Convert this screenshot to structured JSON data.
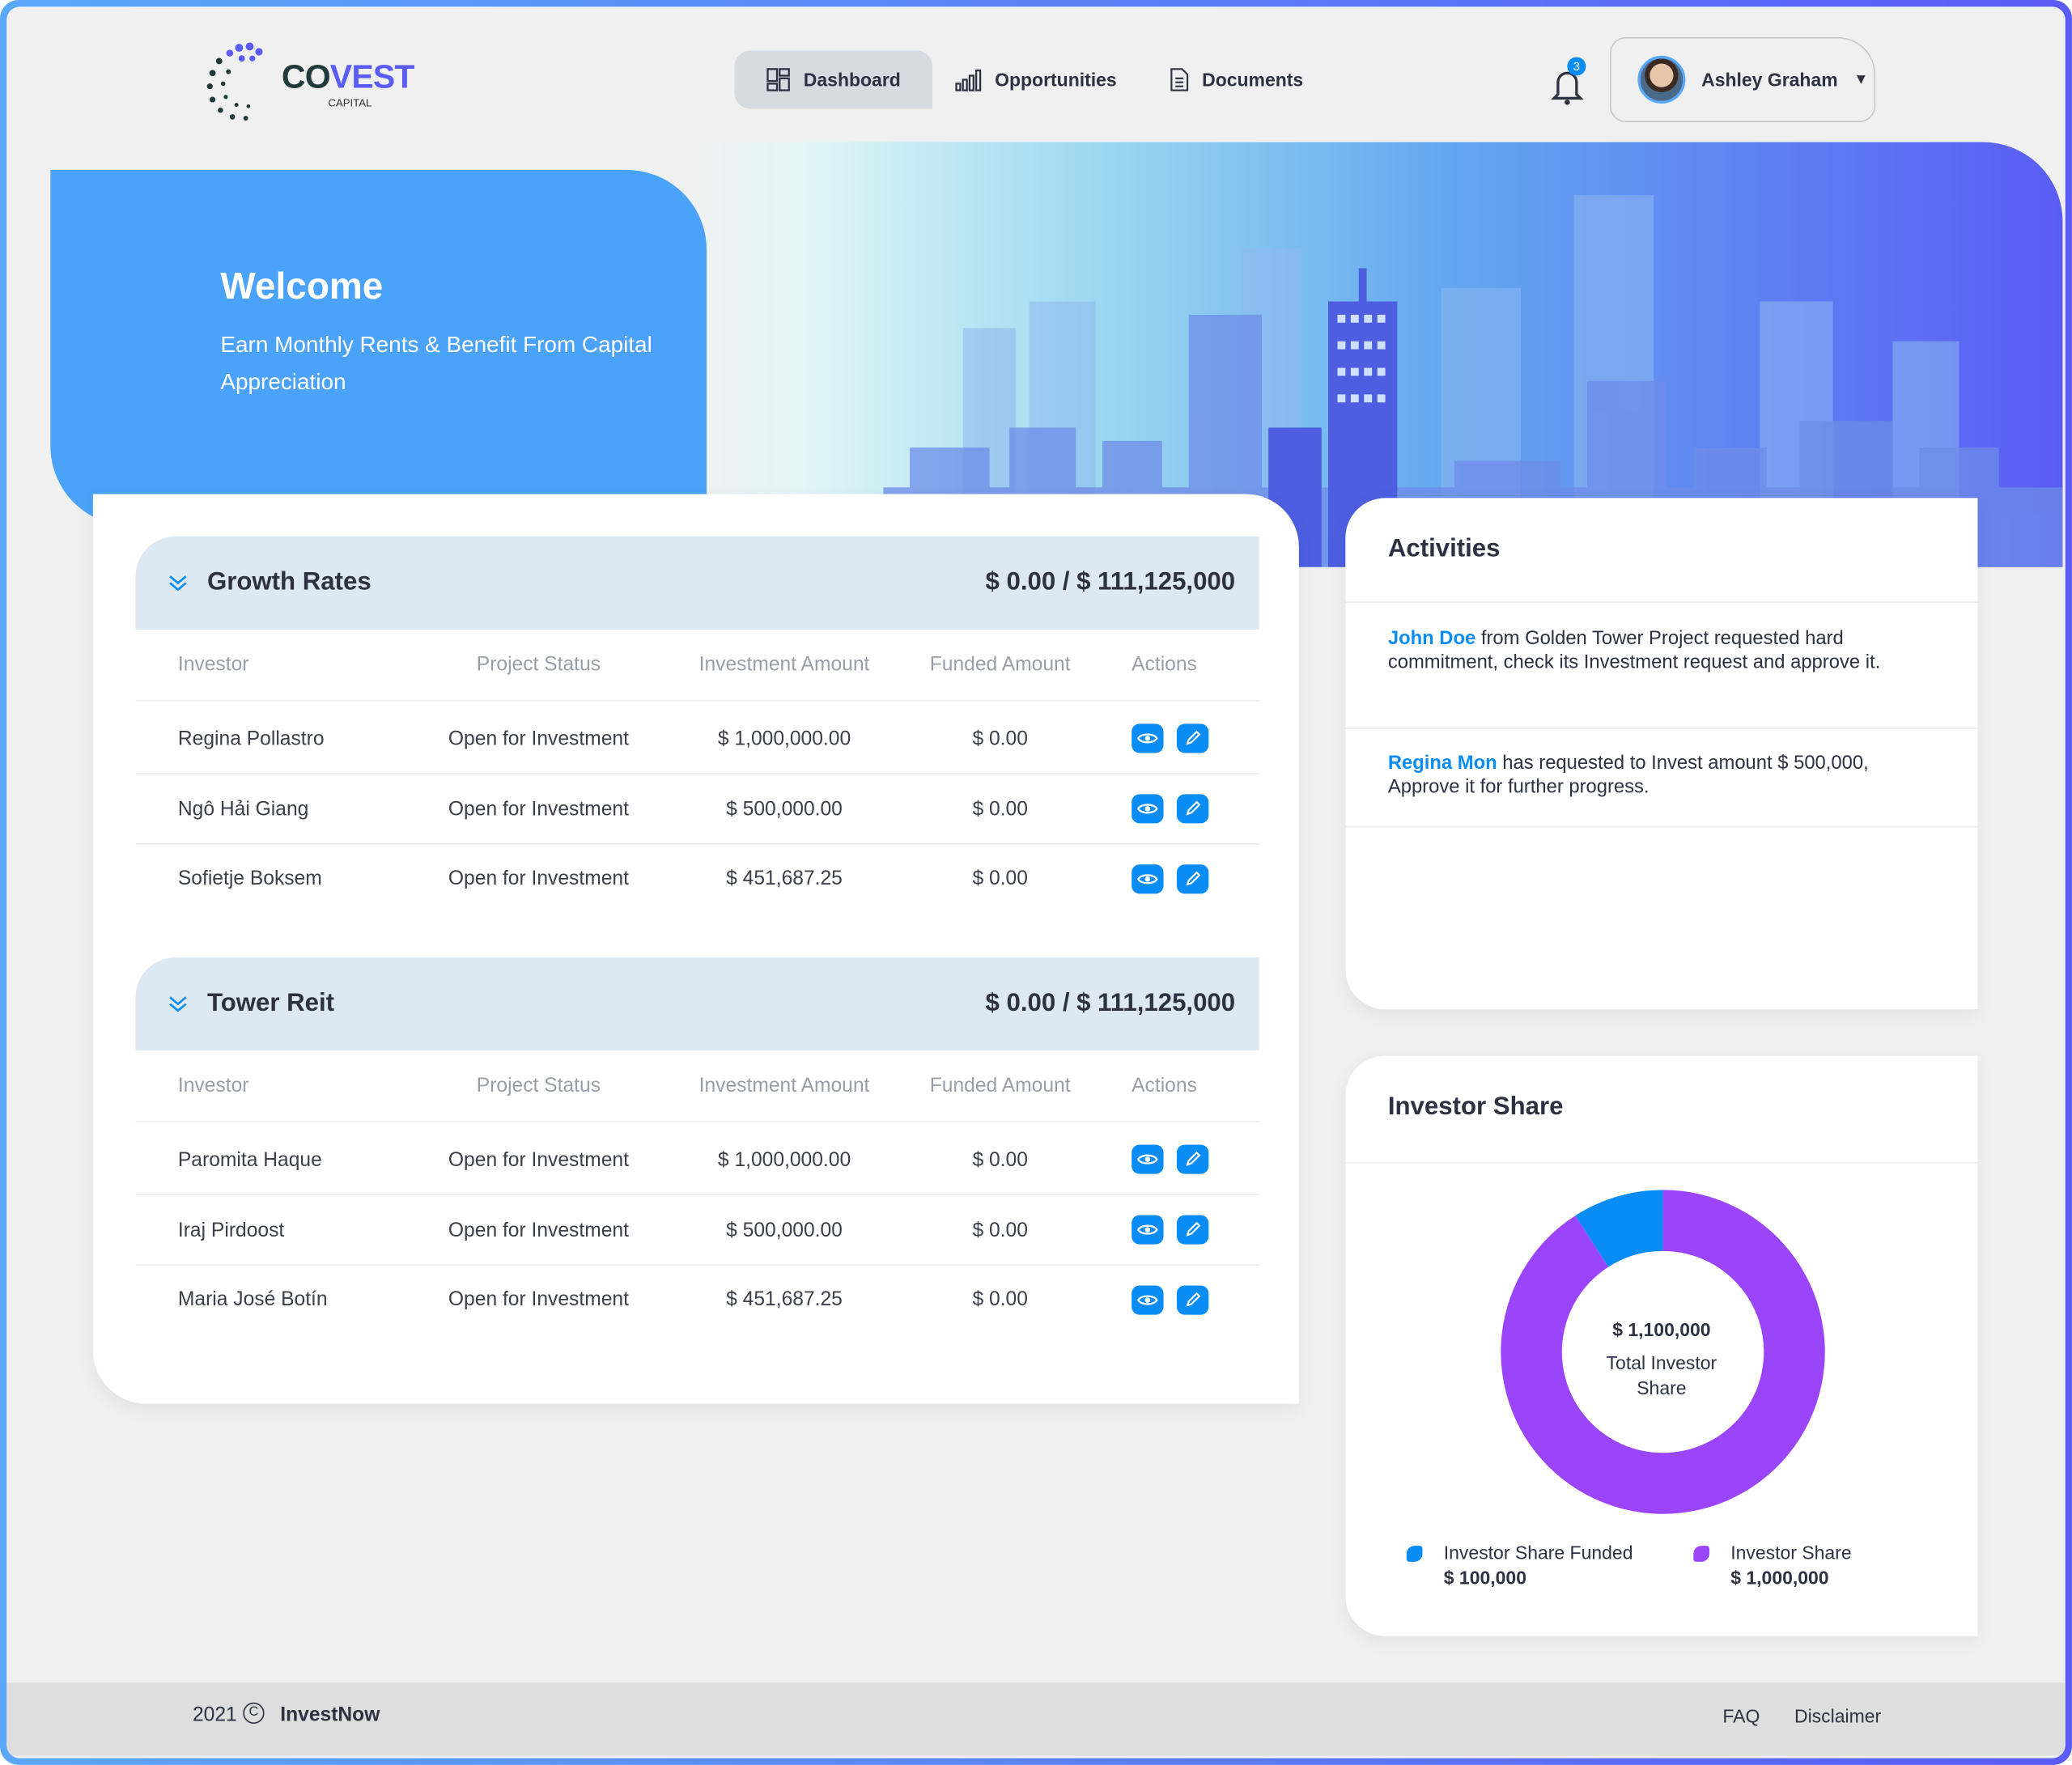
{
  "header": {
    "logo": {
      "text": "COVEST",
      "sub": "CAPITAL"
    },
    "nav": [
      {
        "label": "Dashboard",
        "icon": "dashboard-icon",
        "active": true
      },
      {
        "label": "Opportunities",
        "icon": "bar-chart-icon",
        "active": false
      },
      {
        "label": "Documents",
        "icon": "document-icon",
        "active": false
      }
    ],
    "notifications": {
      "count": "3"
    },
    "user": {
      "name": "Ashley Graham"
    }
  },
  "hero": {
    "title": "Welcome",
    "subtitle": "Earn Monthly Rents & Benefit From Capital Appreciation"
  },
  "columns": [
    "Investor",
    "Project Status",
    "Investment Amount",
    "Funded Amount",
    "Actions"
  ],
  "sections": [
    {
      "title": "Growth Rates",
      "total": "$ 0.00 / $ 111,125,000",
      "rows": [
        {
          "investor": "Regina Pollastro",
          "status": "Open for Investment",
          "investment": "$ 1,000,000.00",
          "funded": "$ 0.00"
        },
        {
          "investor": "Ngô Hải Giang",
          "status": "Open for Investment",
          "investment": "$ 500,000.00",
          "funded": "$ 0.00"
        },
        {
          "investor": "Sofietje Boksem",
          "status": "Open for Investment",
          "investment": "$ 451,687.25",
          "funded": "$ 0.00"
        }
      ]
    },
    {
      "title": "Tower Reit",
      "total": "$ 0.00 / $ 111,125,000",
      "rows": [
        {
          "investor": "Paromita Haque",
          "status": "Open for Investment",
          "investment": "$ 1,000,000.00",
          "funded": "$ 0.00"
        },
        {
          "investor": "Iraj Pirdoost",
          "status": "Open for Investment",
          "investment": "$ 500,000.00",
          "funded": "$ 0.00"
        },
        {
          "investor": "Maria José Botín",
          "status": "Open for Investment",
          "investment": "$ 451,687.25",
          "funded": "$ 0.00"
        }
      ]
    }
  ],
  "activities": {
    "title": "Activities",
    "items": [
      {
        "name": "John Doe",
        "text": " from Golden Tower Project requested hard commitment, check its Investment request and approve it."
      },
      {
        "name": "Regina Mon",
        "text": " has requested to Invest amount $ 500,000, Approve it for further progress."
      }
    ]
  },
  "investor_share": {
    "title": "Investor Share",
    "center_value": "$ 1,100,000",
    "center_label": "Total Investor Share"
  },
  "chart_data": {
    "type": "pie",
    "style": "donut",
    "center_value": "$ 1,100,000",
    "center_label": "Total Investor Share",
    "legend_position": "bottom",
    "series": [
      {
        "name": "Investor Share Funded",
        "value": 100000,
        "label": "$ 100,000",
        "color": "#0a8cf5"
      },
      {
        "name": "Investor Share",
        "value": 1000000,
        "label": "$ 1,000,000",
        "color": "#9b45fb"
      }
    ]
  },
  "footer": {
    "year": "2021",
    "brand": "InvestNow",
    "links": [
      "FAQ",
      "Disclaimer"
    ]
  },
  "colors": {
    "accent": "#0a8cf5",
    "purple": "#9b45fb",
    "welcome": "#4aa3f8",
    "brand_indigo": "#5b5cf5"
  }
}
